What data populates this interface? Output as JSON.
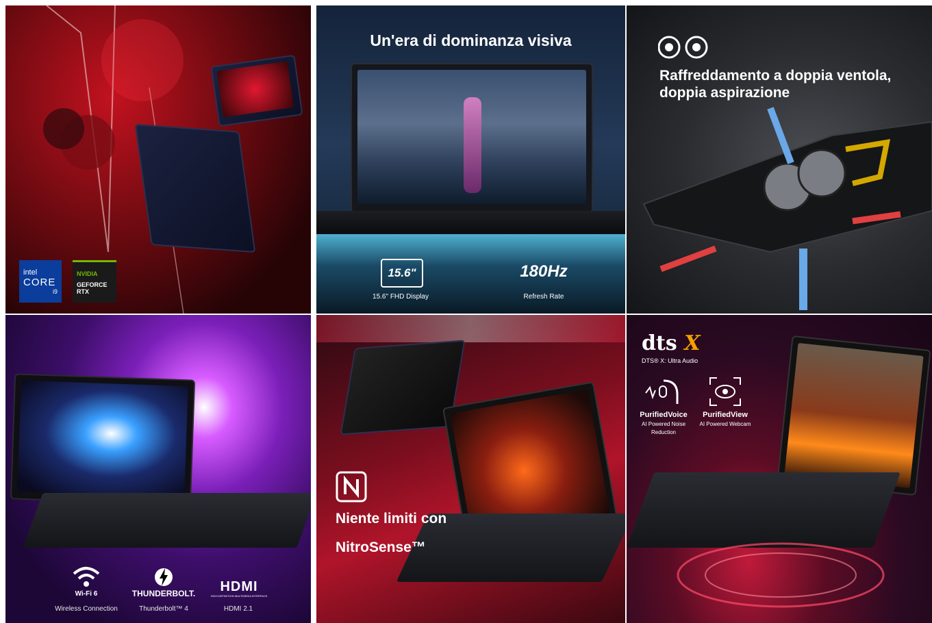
{
  "tile1": {
    "intel": {
      "brand": "intel",
      "line": "CORE",
      "tier": "i9"
    },
    "nvidia": {
      "brand": "NVIDIA",
      "line1": "GEFORCE",
      "line2": "RTX"
    }
  },
  "tile2": {
    "headline": "Un'era di dominanza visiva",
    "display_badge": "15.6\"",
    "display_caption": "15.6\" FHD Display",
    "refresh_badge": "180Hz",
    "refresh_caption": "Refresh Rate"
  },
  "tile3": {
    "headline_line1": "Raffreddamento a doppia ventola,",
    "headline_line2": "doppia aspirazione"
  },
  "tile4": {
    "wifi_badge": "Wi-Fi 6",
    "wifi_caption": "Wireless Connection",
    "tb_badge": "THUNDERBOLT.",
    "tb_caption": "Thunderbolt™ 4",
    "hdmi_badge": "HDMI",
    "hdmi_sub": "HIGH-DEFINITION MULTIMEDIA INTERFACE",
    "hdmi_caption": "HDMI 2.1"
  },
  "tile5": {
    "headline_line1": "Niente limiti con",
    "headline_line2": "NitroSense™"
  },
  "tile6": {
    "dts_logo": "dts",
    "dts_x": "X",
    "dts_caption": "DTS® X: Ultra Audio",
    "voice_title": "PurifiedVoice",
    "voice_line1": "AI Powered Noise",
    "voice_line2": "Reduction",
    "view_title": "PurifiedView",
    "view_line1": "AI Powered Webcam"
  },
  "colors": {
    "accent_red": "#d0142a",
    "nvidia_green": "#76b900",
    "intel_blue": "#0a3d9c",
    "dts_orange": "#f5a000"
  }
}
